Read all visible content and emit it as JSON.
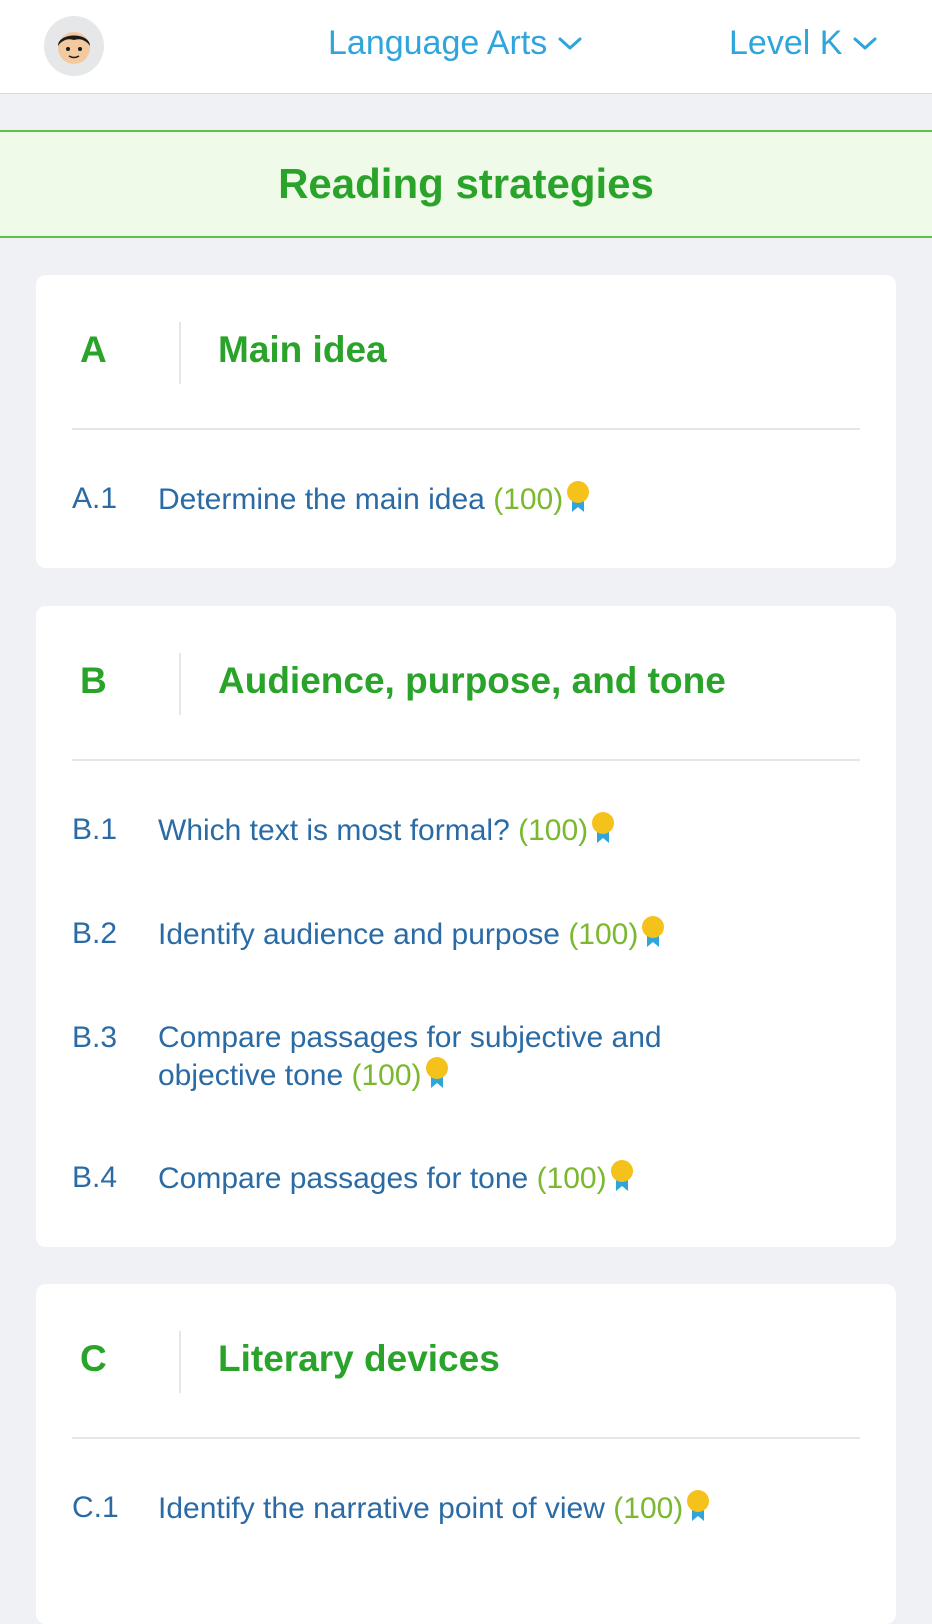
{
  "header": {
    "subject": "Language Arts",
    "level": "Level K"
  },
  "banner": {
    "title": "Reading strategies"
  },
  "sections": [
    {
      "letter": "A",
      "title": "Main idea",
      "skills": [
        {
          "code": "A.1",
          "text": "Determine the main idea",
          "score": "(100)"
        }
      ]
    },
    {
      "letter": "B",
      "title": "Audience, purpose, and tone",
      "skills": [
        {
          "code": "B.1",
          "text": "Which text is most formal?",
          "score": "(100)"
        },
        {
          "code": "B.2",
          "text": "Identify audience and purpose",
          "score": "(100)"
        },
        {
          "code": "B.3",
          "text": "Compare passages for subjective and objective tone",
          "score": "(100)"
        },
        {
          "code": "B.4",
          "text": "Compare passages for tone",
          "score": "(100)"
        }
      ]
    },
    {
      "letter": "C",
      "title": "Literary devices",
      "skills": [
        {
          "code": "C.1",
          "text": "Identify the narrative point of view",
          "score": "(100)"
        }
      ]
    }
  ],
  "colors": {
    "accent_green": "#2aa32a",
    "link_blue": "#2a6ba6",
    "nav_blue": "#2fa5dc",
    "score_green": "#7ab82f",
    "medal_gold": "#f5c21b"
  },
  "icons": [
    "avatar-face-icon",
    "chevron-down-icon",
    "medal-icon"
  ]
}
